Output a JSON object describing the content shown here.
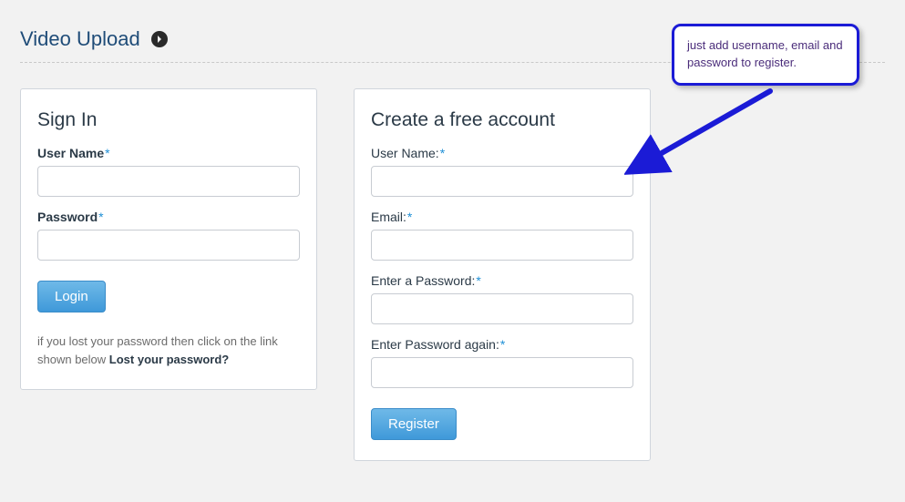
{
  "page": {
    "title": "Video Upload"
  },
  "signin": {
    "title": "Sign In",
    "user_label": "User Name",
    "password_label": "Password",
    "login_button": "Login",
    "lost_intro": "if you lost your password then click on the link shown below ",
    "lost_link": "Lost your password?"
  },
  "register": {
    "title": "Create a free account",
    "user_label": "User Name:",
    "email_label": "Email:",
    "password_label": "Enter a Password:",
    "password2_label": "Enter Password again:",
    "register_button": "Register"
  },
  "callout": {
    "text": "just add username, email and password to register."
  }
}
